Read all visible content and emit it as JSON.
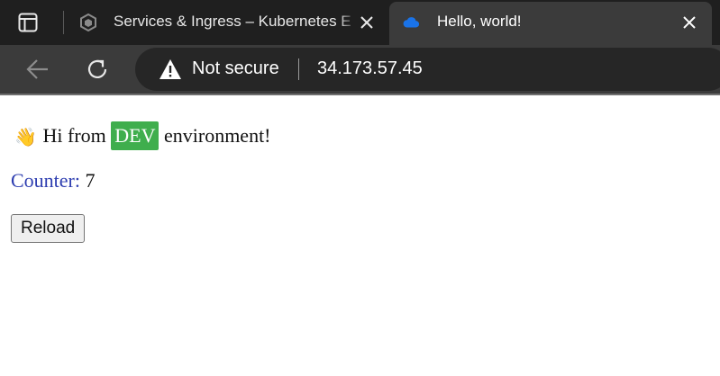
{
  "tabs": [
    {
      "title": "Services & Ingress – Kubernetes E",
      "favicon": "kubernetes-engine-icon",
      "active": false
    },
    {
      "title": "Hello, world!",
      "favicon": "cloud-icon",
      "active": true
    }
  ],
  "toolbar": {
    "security_label": "Not secure",
    "url": "34.173.57.45"
  },
  "page": {
    "greeting_prefix": "Hi from",
    "env_badge": "DEV",
    "greeting_suffix": "environment!",
    "counter_label": "Counter:",
    "counter_value": "7",
    "reload_label": "Reload"
  },
  "colors": {
    "badge_green": "#3fae4d",
    "counter_label_blue": "#2d3db0",
    "favicon_blue": "#1a73e8"
  }
}
